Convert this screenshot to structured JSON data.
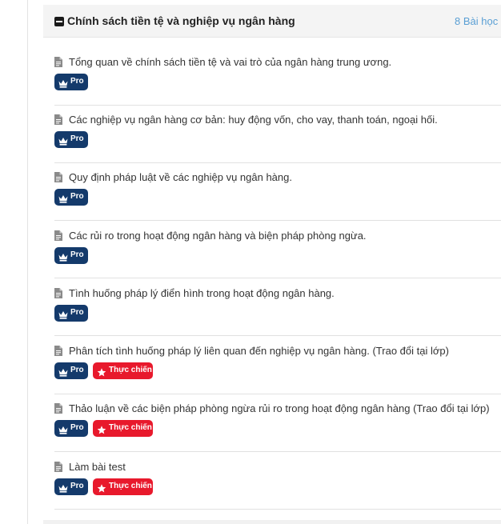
{
  "section": {
    "title": "Chính sách tiền tệ và nghiệp vụ ngân hàng",
    "count_label": "8 Bài học -",
    "toggle_icon": "minus-square-icon"
  },
  "badge_labels": {
    "pro": "Pro",
    "live": "Thực chiến"
  },
  "colors": {
    "pro_badge": "#143a6b",
    "live_badge": "#e8192c",
    "count_text": "#5a9fd4",
    "header_bg": "#f4f4f4"
  },
  "lessons": [
    {
      "title": "Tổng quan về chính sách tiền tệ và vai trò của ngân hàng trung ương.",
      "icon": "document-icon",
      "badges": [
        "pro"
      ]
    },
    {
      "title": "Các nghiệp vụ ngân hàng cơ bản: huy động vốn, cho vay, thanh toán, ngoại hối.",
      "icon": "document-icon",
      "badges": [
        "pro"
      ]
    },
    {
      "title": "Quy định pháp luật về các nghiệp vụ ngân hàng.",
      "icon": "document-icon",
      "badges": [
        "pro"
      ]
    },
    {
      "title": "Các rủi ro trong hoạt động ngân hàng và biện pháp phòng ngừa.",
      "icon": "document-icon",
      "badges": [
        "pro"
      ]
    },
    {
      "title": "Tình huống pháp lý điển hình trong hoạt động ngân hàng.",
      "icon": "document-icon",
      "badges": [
        "pro"
      ]
    },
    {
      "title": "Phân tích tình huống pháp lý liên quan đến nghiệp vụ ngân hàng. (Trao đổi tại lớp)",
      "icon": "document-icon",
      "badges": [
        "pro",
        "live"
      ]
    },
    {
      "title": "Thảo luận về các biện pháp phòng ngừa rủi ro trong hoạt động ngân hàng (Trao đổi tại lớp)",
      "icon": "document-icon",
      "badges": [
        "pro",
        "live"
      ]
    },
    {
      "title": "Làm bài test",
      "icon": "document-icon",
      "badges": [
        "pro",
        "live"
      ]
    }
  ]
}
